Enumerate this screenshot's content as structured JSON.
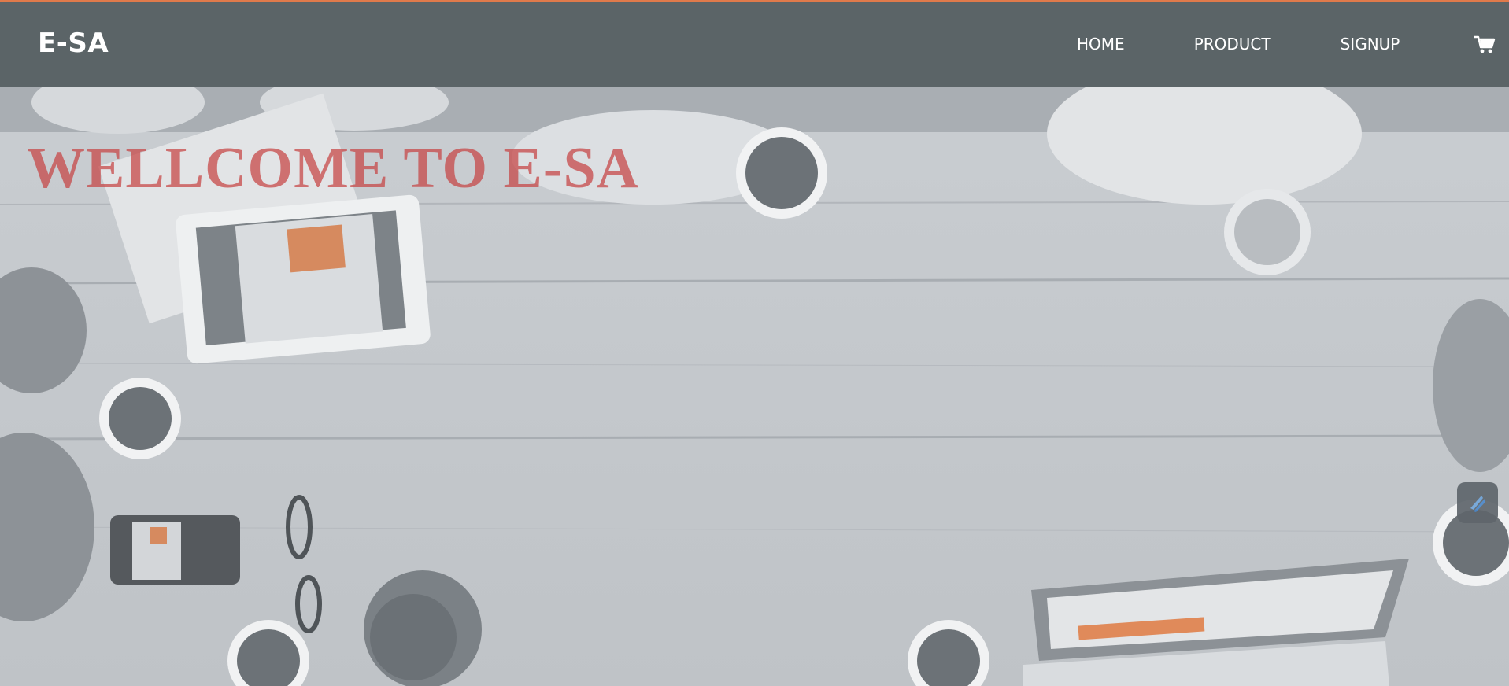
{
  "brand": {
    "name": "E-SA"
  },
  "nav": {
    "items": [
      {
        "label": "HOME"
      },
      {
        "label": "PRODUCT"
      },
      {
        "label": "SIGNUP"
      }
    ],
    "cart_icon": "shopping-cart-icon"
  },
  "hero": {
    "title": "WELLCOME TO E-SA",
    "background": "desaturated overhead photo of people around a wooden table with coffee cups, tablet and laptop"
  },
  "colors": {
    "accent": "#e07a4b",
    "navbar": "#5b6467",
    "title": "#c64242"
  }
}
